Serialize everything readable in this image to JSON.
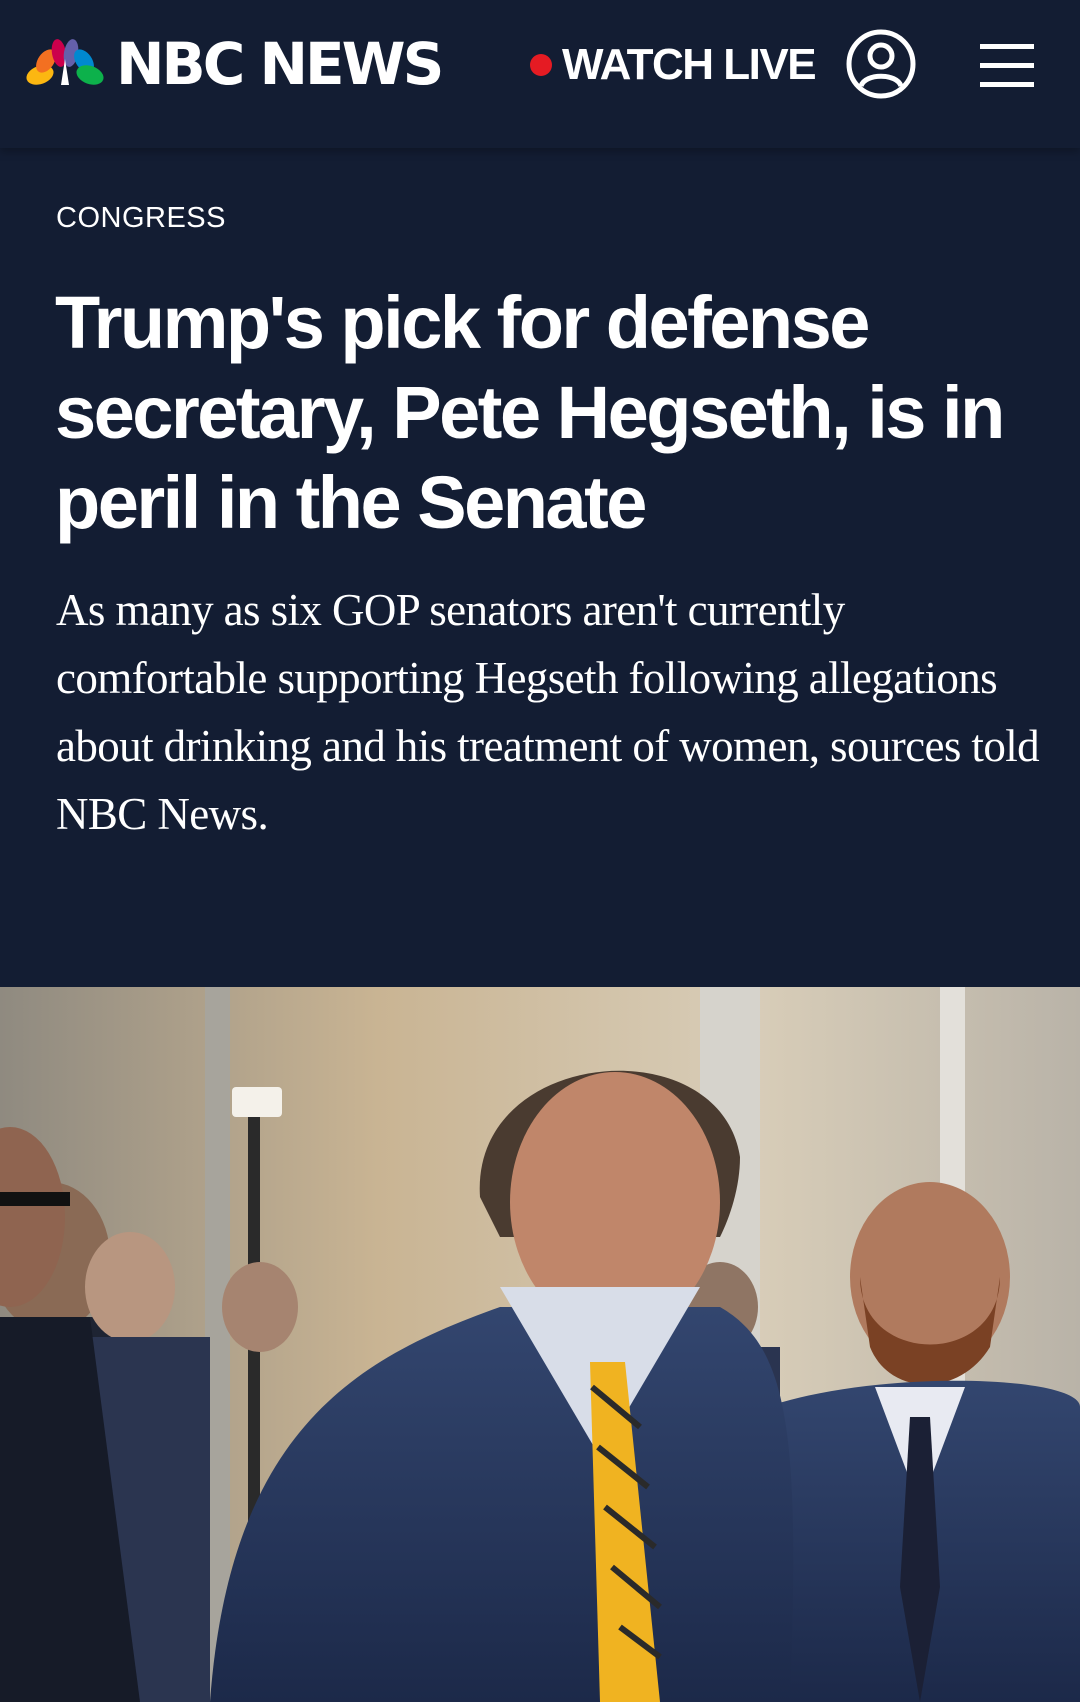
{
  "header": {
    "brand": "NBC NEWS",
    "logo_icon": "nbc-peacock-icon",
    "watch_live_label": "WATCH LIVE",
    "account_icon": "user-account-icon",
    "menu_icon": "hamburger-menu-icon"
  },
  "article": {
    "section": "CONGRESS",
    "headline": "Trump's pick for defense secretary, Pete Hegseth, is in peril in the Senate",
    "dek": "As many as six GOP senators aren't currently comfortable supporting Hegseth following allegations about drinking and his treatment of women, sources told NBC News."
  },
  "colors": {
    "background": "#131d33",
    "live_dot": "#e51b23",
    "text": "#ffffff"
  }
}
